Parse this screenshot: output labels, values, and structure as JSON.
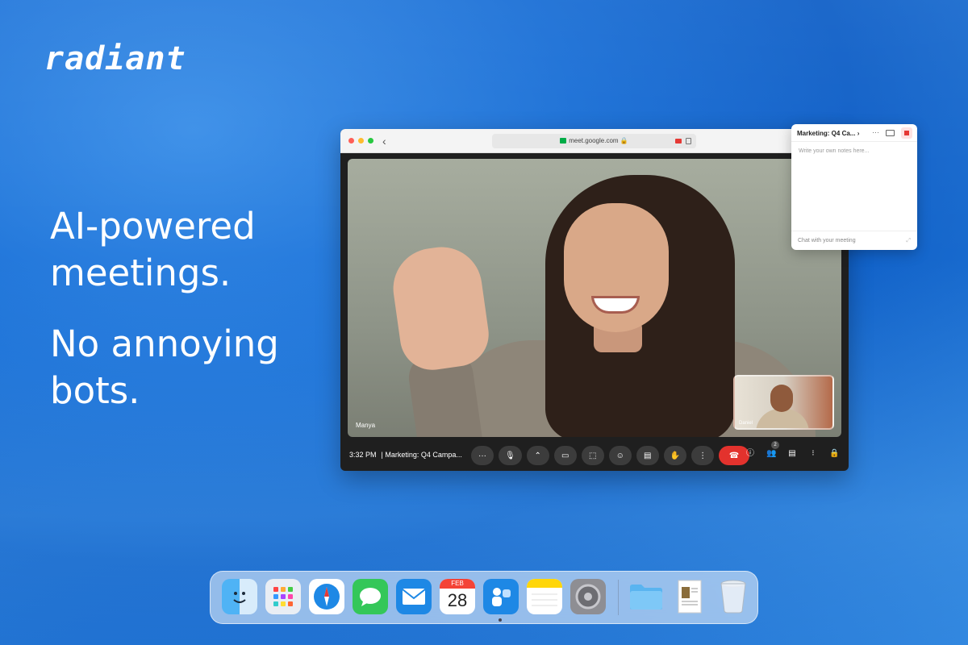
{
  "brand": {
    "logo_text": "radiant"
  },
  "headline": {
    "line1": "AI-powered meetings.",
    "line2": "No annoying bots."
  },
  "browser": {
    "url": "meet.google.com",
    "traffic_colors": [
      "#ff5f57",
      "#febc2e",
      "#28c840"
    ]
  },
  "meeting": {
    "main_participant": "Manya",
    "pip_participant": "Daniel",
    "time": "3:32 PM",
    "title": "Marketing: Q4 Campa...",
    "participant_count": "2",
    "controls": [
      "more",
      "mic",
      "camera-options",
      "camera",
      "present",
      "emoji",
      "captions",
      "raise-hand",
      "more-vert",
      "end-call"
    ]
  },
  "notes": {
    "title": "Marketing: Q4 Ca...",
    "placeholder": "Write your own notes here...",
    "chat_placeholder": "Chat with your meeting"
  },
  "dock": {
    "calendar_month": "FEB",
    "calendar_day": "28",
    "apps": [
      "finder",
      "launchpad",
      "safari",
      "messages",
      "mail",
      "calendar",
      "radiant",
      "notes",
      "system-settings",
      "folder",
      "document",
      "trash"
    ]
  },
  "colors": {
    "accent": "#1a6fd6",
    "end_call": "#e3322d",
    "record": "#e53935"
  }
}
